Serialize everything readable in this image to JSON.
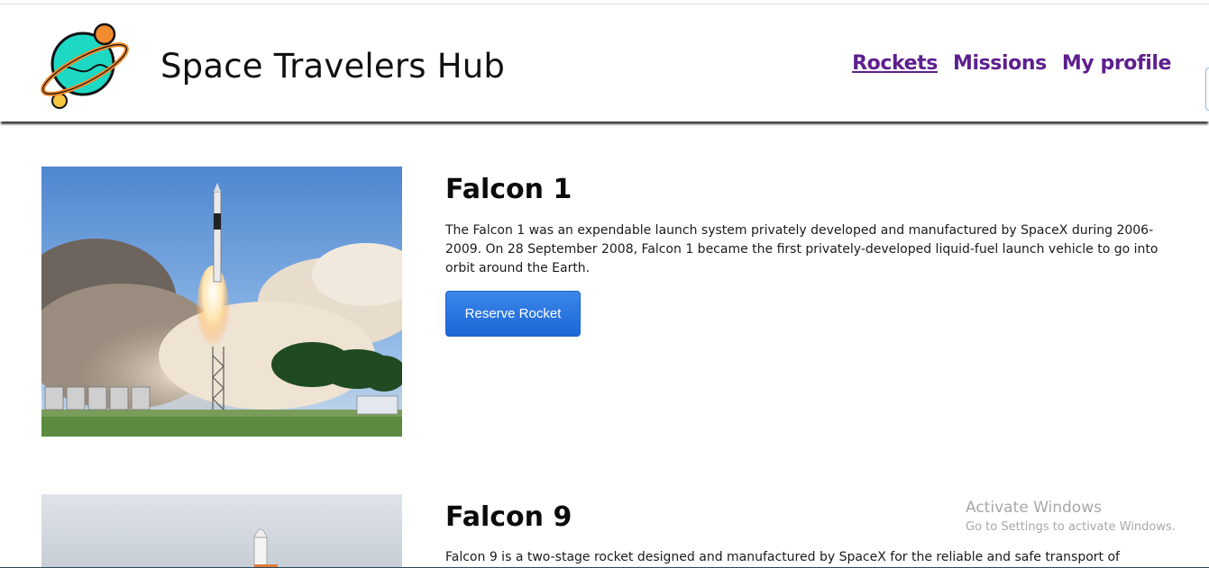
{
  "app": {
    "title": "Space Travelers Hub"
  },
  "nav": {
    "items": [
      {
        "label": "Rockets",
        "active": true
      },
      {
        "label": "Missions",
        "active": false
      },
      {
        "label": "My profile",
        "active": false
      }
    ]
  },
  "rockets": [
    {
      "name": "Falcon 1",
      "description": "The Falcon 1 was an expendable launch system privately developed and manufactured by SpaceX during 2006-2009. On 28 September 2008, Falcon 1 became the first privately-developed liquid-fuel launch vehicle to go into orbit around the Earth.",
      "button_label": "Reserve Rocket"
    },
    {
      "name": "Falcon 9",
      "description": "Falcon 9 is a two-stage rocket designed and manufactured by SpaceX for the reliable and safe transport of"
    }
  ],
  "watermark": {
    "title": "Activate Windows",
    "subtitle": "Go to Settings to activate Windows."
  },
  "colors": {
    "nav_link": "#5e1f8e",
    "button": "#2b76e0",
    "planet": "#1dd9c4",
    "moon": "#f28b2e"
  }
}
